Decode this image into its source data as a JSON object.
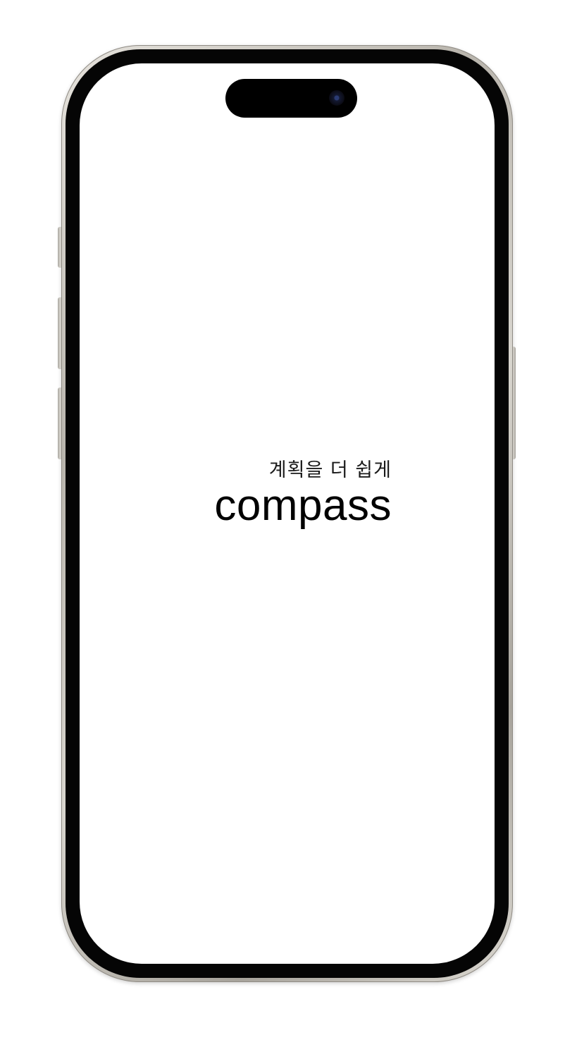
{
  "splash": {
    "tagline": "계획을 더 쉽게",
    "app_name": "compass"
  },
  "colors": {
    "screen_background": "#ffffff",
    "text_primary": "#000000",
    "bezel": "#050505",
    "frame": "#d9d6cf"
  }
}
